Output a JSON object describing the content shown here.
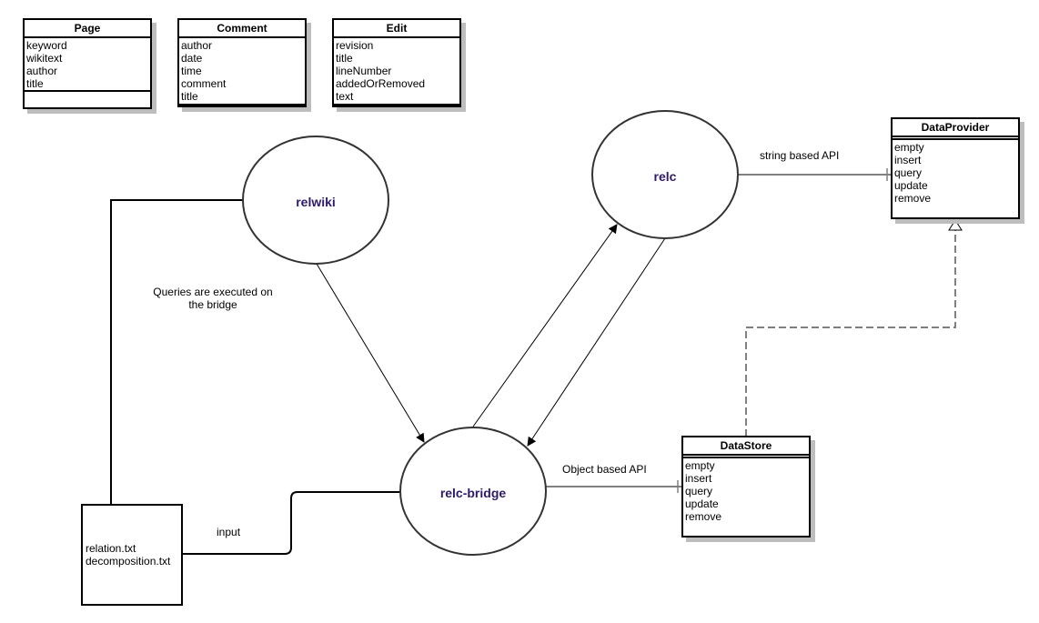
{
  "entities": [
    {
      "name": "Page",
      "attributes": [
        "keyword",
        "wikitext",
        "author",
        "title"
      ]
    },
    {
      "name": "Comment",
      "attributes": [
        "author",
        "date",
        "time",
        "comment",
        "title"
      ]
    },
    {
      "name": "Edit",
      "attributes": [
        "revision",
        "title",
        "lineNumber",
        "addedOrRemoved",
        "text"
      ]
    }
  ],
  "interfaces": {
    "data_provider": {
      "name": "DataProvider",
      "methods": [
        "empty",
        "insert",
        "query",
        "update",
        "remove"
      ]
    },
    "data_store": {
      "name": "DataStore",
      "methods": [
        "empty",
        "insert",
        "query",
        "update",
        "remove"
      ]
    }
  },
  "nodes": {
    "relwiki": "relwiki",
    "relc": "relc",
    "relc_bridge": "relc-bridge"
  },
  "files": {
    "lines": [
      "relation.txt",
      "decomposition.txt"
    ]
  },
  "labels": {
    "queries": [
      "Queries are executed on",
      "the bridge"
    ],
    "string_api": "string based API",
    "object_api": "Object based API",
    "input": "input"
  },
  "colors": {
    "node_text": "#2e1a6b",
    "dashed_line": "#808080",
    "shadow": "#bdbdbd"
  }
}
